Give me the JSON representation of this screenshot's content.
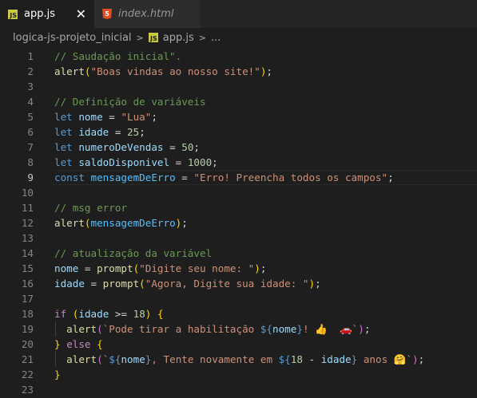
{
  "tabs": [
    {
      "label": "app.js",
      "icon": "js-file-icon",
      "close": "✕",
      "active": true
    },
    {
      "label": "index.html",
      "icon": "html5-file-icon",
      "active": false
    }
  ],
  "breadcrumb": {
    "folder": "logica-js-projeto_inicial",
    "file": "app.js",
    "trail": "..."
  },
  "current_line": 9,
  "code": {
    "l1": "// Saudação inicial\".",
    "l2_fn": "alert",
    "l2_str": "\"Boas vindas ao nosso site!\"",
    "l4": "// Definição de variáveis",
    "l5_name": "nome",
    "l5_val": "\"Lua\"",
    "l6_name": "idade",
    "l6_val": "25",
    "l7_name": "numeroDeVendas",
    "l7_val": "50",
    "l8_name": "saldoDisponivel",
    "l8_val": "1000",
    "l9_name": "mensagemDeErro",
    "l9_val": "\"Erro! Preencha todos os campos\"",
    "l11": "// msg error",
    "l12_fn": "alert",
    "l12_arg": "mensagemDeErro",
    "l14": "// atualização da variável",
    "l15_var": "nome",
    "l15_fn": "prompt",
    "l15_str": "\"Digite seu nome: \"",
    "l16_var": "idade",
    "l16_fn": "prompt",
    "l16_str": "\"Agora, Digite sua idade: \"",
    "l18_var": "idade",
    "l18_num": "18",
    "l19_fn": "alert",
    "l19_s1": "`Pode tirar a habilitação ",
    "l19_var": "nome",
    "l19_s2": "! 👍  🚗`",
    "l20_kw": "else",
    "l21_fn": "alert",
    "l21_var1": "nome",
    "l21_s1": ", Tente novamente em ",
    "l21_num": "18",
    "l21_var2": "idade",
    "l21_s2": " anos 🤗`"
  }
}
